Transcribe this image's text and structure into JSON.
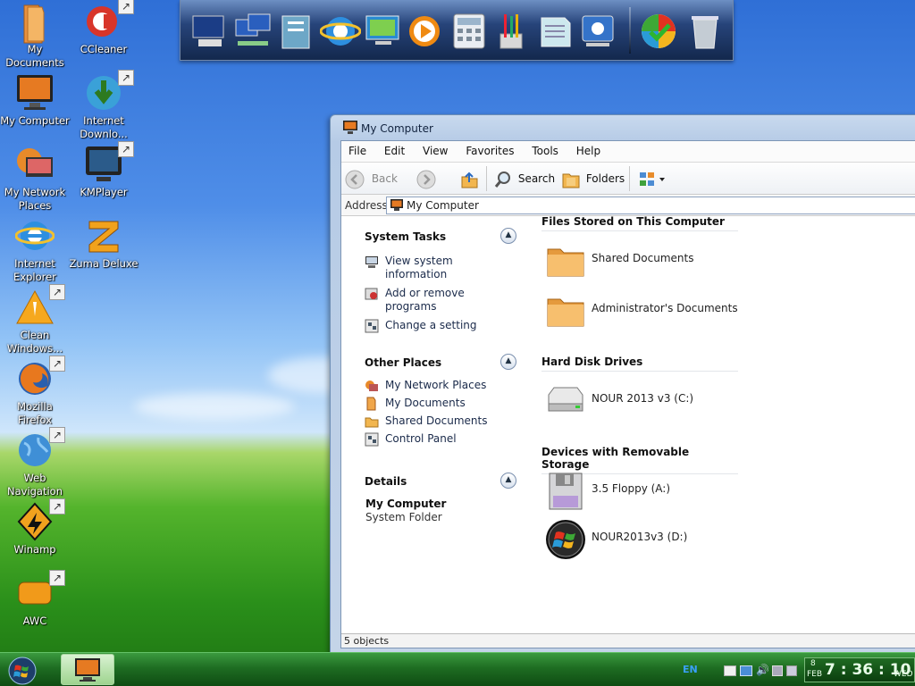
{
  "desktop": {
    "icons": [
      {
        "name": "My Documents",
        "id": "my-documents"
      },
      {
        "name": "CCleaner",
        "id": "ccleaner"
      },
      {
        "name": "My Computer",
        "id": "my-computer"
      },
      {
        "name": "Internet Downlo...",
        "id": "internet-download-manager"
      },
      {
        "name": "My Network Places",
        "id": "my-network-places"
      },
      {
        "name": "KMPlayer",
        "id": "kmplayer"
      },
      {
        "name": "Internet Explorer",
        "id": "internet-explorer"
      },
      {
        "name": "Zuma Deluxe",
        "id": "zuma-deluxe"
      },
      {
        "name": "Clean Windows...",
        "id": "clean-windows"
      },
      {
        "name": "Mozilla Firefox",
        "id": "mozilla-firefox"
      },
      {
        "name": "Web Navigation",
        "id": "web-navigation"
      },
      {
        "name": "Winamp",
        "id": "winamp"
      },
      {
        "name": "AWC",
        "id": "awc"
      }
    ]
  },
  "dock": {
    "items": [
      "my-computer-icon",
      "network-icon",
      "documents-icon",
      "internet-explorer-icon",
      "monitor-icon",
      "media-player-icon",
      "calculator-icon",
      "paint-icon",
      "notepad-icon",
      "control-panel-icon",
      "windows-update-icon",
      "recycle-bin-icon"
    ]
  },
  "window": {
    "title": "My Computer",
    "menu": [
      "File",
      "Edit",
      "View",
      "Favorites",
      "Tools",
      "Help"
    ],
    "toolbar": {
      "back": "Back",
      "search": "Search",
      "folders": "Folders"
    },
    "address": {
      "label": "Address",
      "value": "My Computer"
    },
    "tasks": {
      "system": {
        "title": "System Tasks",
        "items": [
          "View system information",
          "Add or remove programs",
          "Change a setting"
        ]
      },
      "other": {
        "title": "Other Places",
        "items": [
          "My Network Places",
          "My Documents",
          "Shared Documents",
          "Control Panel"
        ]
      },
      "details": {
        "title": "Details",
        "name": "My Computer",
        "type": "System Folder"
      }
    },
    "sections": {
      "files": {
        "title": "Files Stored on This Computer",
        "items": [
          "Shared Documents",
          "Administrator's Documents"
        ]
      },
      "hdd": {
        "title": "Hard Disk Drives",
        "items": [
          "NOUR 2013 v3 (C:)"
        ]
      },
      "removable": {
        "title": "Devices with Removable Storage",
        "items": [
          "3.5 Floppy (A:)",
          "NOUR2013v3 (D:)"
        ]
      }
    },
    "status": "5 objects"
  },
  "taskbar": {
    "language": "EN",
    "clock": {
      "time": "7 : 36 : 10",
      "day": "8",
      "month": "FEB",
      "weekday": "WED"
    }
  },
  "colors": {
    "accent": "#1e6d22",
    "window_border": "#6e8fb5",
    "link": "#1a2a4a"
  }
}
